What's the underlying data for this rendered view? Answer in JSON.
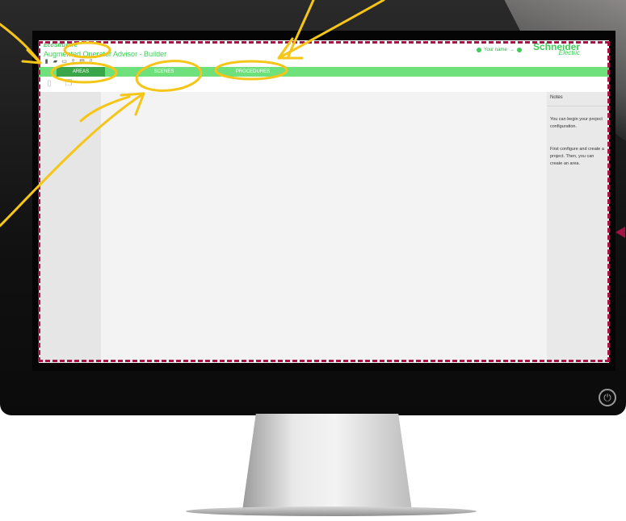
{
  "app": {
    "brand": "EcoStruxure",
    "title": "Augmented Operator Advisor - Builder",
    "toolbar_icons": [
      "new-file-icon",
      "open-folder-icon",
      "save-icon",
      "upload-icon",
      "print-icon",
      "document-icon"
    ],
    "user_name": "Your name",
    "user_arrow": "→",
    "company": "Schneider",
    "company_sub": "Electric"
  },
  "nav": {
    "tabs": [
      {
        "label": "AREAS",
        "active": true
      },
      {
        "label": "SCENES",
        "active": false
      },
      {
        "label": "PROCEDURES",
        "active": false
      }
    ]
  },
  "notes": {
    "title": "Notes",
    "text1": "You can begin your project configuration.",
    "text2": "First configure and create a project. Then, you can create an area."
  },
  "colors": {
    "brand_green": "#3dcd58",
    "nav_green": "#6ee07c",
    "active_tab": "#3aa64a",
    "annotation_yellow": "#f5c518",
    "dashed_frame": "#a51345"
  }
}
